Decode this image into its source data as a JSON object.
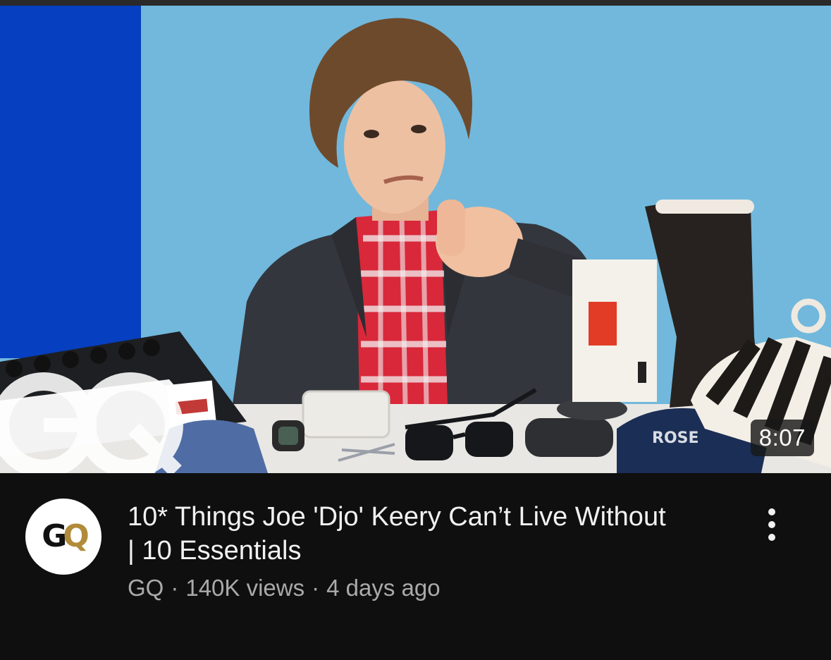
{
  "video": {
    "duration": "8:07",
    "title": "10* Things Joe 'Djo' Keery Can’t Live Without | 10 Essentials",
    "channel": "GQ",
    "views": "140K views",
    "age": "4 days ago",
    "separator": "·"
  },
  "avatar": {
    "label": "GQ"
  },
  "thumbnail": {
    "watermark": "GQ",
    "boot_brand": "ROSE"
  },
  "icons": {
    "menu": "more-vert-icon"
  },
  "colors": {
    "background": "#0f0f0f",
    "backdrop_light_blue": "#71b8dc",
    "backdrop_dark_blue": "#063fc0",
    "title_text": "#f1f1f1",
    "secondary_text": "#aaaaaa"
  }
}
